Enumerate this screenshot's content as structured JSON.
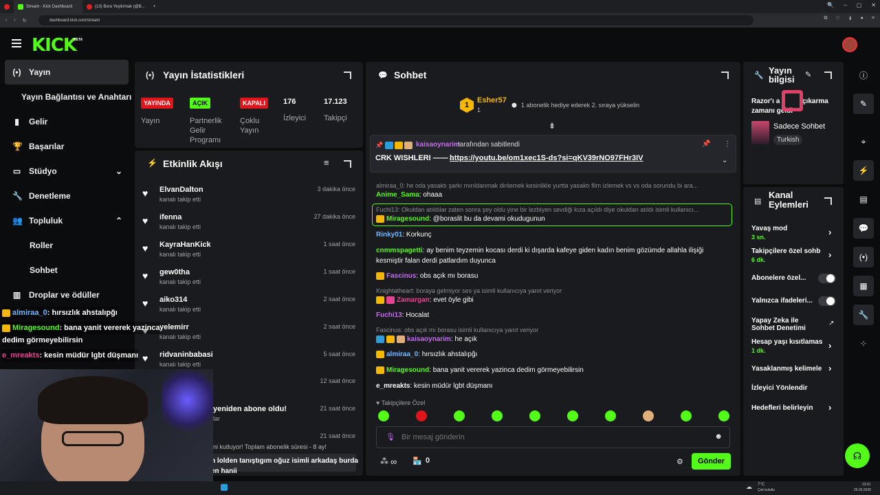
{
  "browser": {
    "tabs": [
      {
        "title": "Stream - Kick Dashboard"
      },
      {
        "title": "(13) Bora Yeşilırmak (@B..."
      }
    ],
    "new_tab": "+",
    "url": "dashboard.kick.com/stream",
    "window_controls": [
      "🔍",
      "–",
      "▢",
      "✕"
    ]
  },
  "brand": {
    "logo": "KICK",
    "beta": "BETA",
    "accent": "#53fc18"
  },
  "sidebar": {
    "items": [
      {
        "icon": "(•)",
        "label": "Yayın"
      },
      {
        "icon": "",
        "label": "Yayın Bağlantısı ve Anahtarı"
      },
      {
        "icon": "▮",
        "label": "Gelir"
      },
      {
        "icon": "🏆",
        "label": "Başarılar"
      },
      {
        "icon": "▭",
        "label": "Stüdyo"
      },
      {
        "icon": "🔧",
        "label": "Denetleme"
      },
      {
        "icon": "👥",
        "label": "Topluluk"
      },
      {
        "icon": "",
        "label": "Roller"
      },
      {
        "icon": "",
        "label": "Sohbet"
      },
      {
        "icon": "▥",
        "label": "Droplar ve ödüller"
      }
    ]
  },
  "stats": {
    "title": "Yayın İstatistikleri",
    "badges": [
      {
        "text": "YAYINDA",
        "label": "Yayın"
      },
      {
        "text": "AÇIK",
        "label": "Partnerlik Gelir Programı"
      },
      {
        "text": "KAPALI",
        "label": "Çoklu Yayın"
      }
    ],
    "viewers": {
      "value": "176",
      "label": "İzleyici"
    },
    "followers": {
      "value": "17.123",
      "label": "Takipçi"
    }
  },
  "activity": {
    "title": "Etkinlik Akışı",
    "events": [
      {
        "name": "ElvanDalton",
        "sub": "kanalı takip etti",
        "time": "3 dakika önce"
      },
      {
        "name": "ifenna",
        "sub": "kanalı takip etti",
        "time": "27 dakika önce"
      },
      {
        "name": "KayraHanKick",
        "sub": "kanalı takip etti",
        "time": "1 saat önce"
      },
      {
        "name": "gew0tha",
        "sub": "kanalı takip etti",
        "time": "1 saat önce"
      },
      {
        "name": "aiko314",
        "sub": "kanalı takip etti",
        "time": "2 saat önce"
      },
      {
        "name": "yelemirr",
        "sub": "kanalı takip etti",
        "time": "2 saat önce"
      },
      {
        "name": "ridvaninbabasi",
        "sub": "kanalı takip etti",
        "time": "5 saat önce"
      },
      {
        "name": "",
        "sub": "",
        "time": "12 saat önce"
      },
      {
        "name": "yeniden abone oldu!",
        "sub": "lar",
        "time": "21 saat önce"
      },
      {
        "name": "",
        "sub": "",
        "time": "21 saat önce"
      }
    ],
    "resub_line": "ni kutluyor! Toplam abonelik süresi - 8 ay!",
    "resub_msg": "n lolden tanıştıgım oğuz isimli arkadaş burda",
    "resub_msg2": "en hanii"
  },
  "overlay": {
    "messages": [
      {
        "user": "almiraa_0",
        "text": ": hırsızlık ahstalıpğı"
      },
      {
        "user": "Miragesound",
        "text": ": bana yanit vererek yazinca"
      },
      {
        "user": "",
        "text": "dedim görmeyebilirsin"
      },
      {
        "user": "e_mreakts",
        "text": ": kesin müdür lgbt düşmanı"
      }
    ]
  },
  "chat": {
    "title": "Sohbet",
    "gift": {
      "user": "Esher57",
      "rank": "1",
      "count": "1",
      "text": "1 abonelik hediye ederek 2. sıraya yükselin"
    },
    "pinned": {
      "by": "kaisaoynarim",
      "by_suffix": "tarafından sabitlendi",
      "text": "CRK WISHLERI ——→",
      "link": "https://youtu.be/om1xec1S-ds?si=qKV39rNO97FHr3IV"
    },
    "messages": [
      {
        "reply": "almiraa_0: he oda yasaktı şarkı mırıldanmak dinlemek kesinlikle yurtta yasaktı film izlemek vs vs oda sorundu bi ara..."
      },
      {
        "user": "Anime_Sama",
        "text": "ohaaa",
        "color": "#53fc18"
      },
      {
        "reply": "Fuchi13: Okuldan atıldılar zaten sonra şey oldu yine bir lezbiyen sevdiği kıza açıldı diye okuldan atıldı isimli kullanıcı..."
      },
      {
        "user": "Miragesound",
        "text": "@boraslit bu da devami okudugunun",
        "color": "#53fc18"
      },
      {
        "user": "Rinky01",
        "text": "Korkunç",
        "color": "#74b9ff"
      },
      {
        "user": "cnmmspagetti",
        "text": "ay benim teyzemin kocası derdi ki dışarda kafeye giden kadın benim gözümde allahla ilişiği",
        "color": "#53fc18"
      },
      {
        "text": "kesmiştir falan derdi patlardım duyunca"
      },
      {
        "user": "Fascinus",
        "text": "obs açık mı borasu",
        "color": "#c56cf0"
      },
      {
        "reply": "Knightatheart: boraya gelmiyor ses ya isimli kullanıcıya yanıt veriyor"
      },
      {
        "user": "Zamargan",
        "text": "evet öyle gibi",
        "color": "#e84393"
      },
      {
        "user": "Fuchi13",
        "text": "Hocalat",
        "color": "#c56cf0"
      },
      {
        "reply": "Fascinus: obs açık mı borasu isimli kullanıcıya yanıt veriyor"
      },
      {
        "user": "kaisaoynarim",
        "text": "he açık",
        "color": "#c56cf0"
      },
      {
        "user": "almiraa_0",
        "text": "hırsızlık ahstalıpğı",
        "color": "#74b9ff"
      },
      {
        "user": "Miragesound",
        "text": "bana yanit vererek yazinca dedim görmeyebilirsin",
        "color": "#53fc18"
      },
      {
        "user": "e_mreakts",
        "text": "kesin müdür lgbt düşmanı",
        "color": "#fff"
      }
    ],
    "emote_section": "Takipçilere Özel",
    "input_placeholder": "Bir mesaj gönderin",
    "points": "∞",
    "shop_count": "0",
    "send": "Gönder"
  },
  "stream_info": {
    "title": "Yayın bilgisi",
    "stream_title_a": "Razor'ı a",
    "stream_title_b": "çıkarma",
    "stream_title_c": "zamanı geldi",
    "category": "Sadece Sohbet",
    "language": "Turkish"
  },
  "channel_actions": {
    "title": "Kanal Eylemleri",
    "items": [
      {
        "label": "Yavaş mod",
        "sub": "3 sn."
      },
      {
        "label": "Takipçilere özel sohb",
        "sub": "6 dk."
      },
      {
        "label": "Abonelere özel...",
        "sub": ""
      },
      {
        "label": "Yalnızca ifadeleri...",
        "sub": ""
      },
      {
        "label": "Yapay Zeka ile Sohbet Denetimi",
        "sub": ""
      },
      {
        "label": "Hesap yaşı kısıtlamas",
        "sub": "1 dk."
      },
      {
        "label": "Yasaklanmış kelimele",
        "sub": ""
      },
      {
        "label": "İzleyici Yönlendir",
        "sub": ""
      },
      {
        "label": "Hedefleri belirleyin",
        "sub": ""
      }
    ]
  },
  "taskbar": {
    "weather": "7°C",
    "weather_desc": "Çok bulutlu",
    "time": "23:01",
    "date": "26.03.2026"
  }
}
